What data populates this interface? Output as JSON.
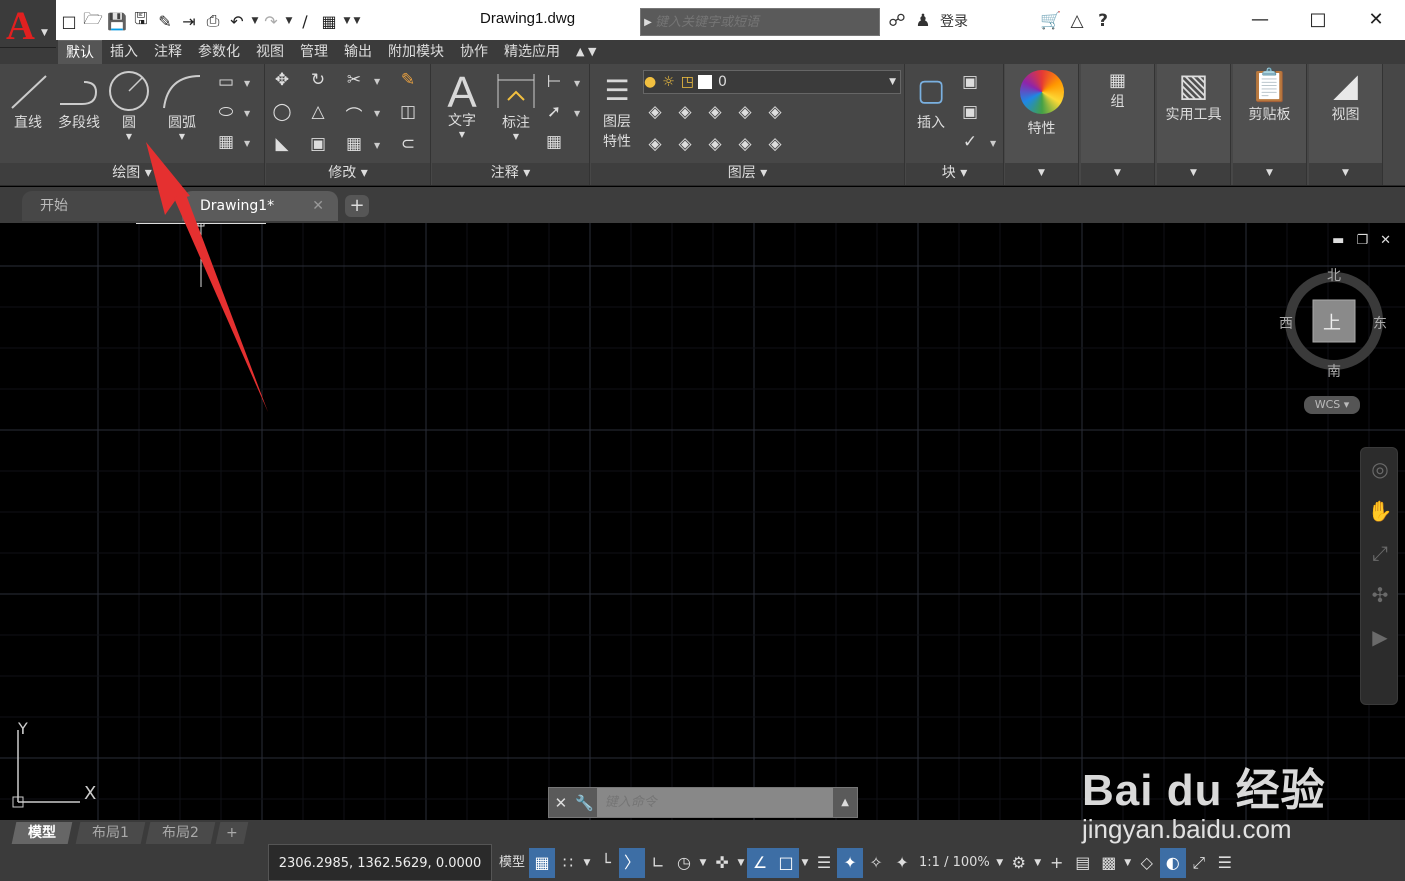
{
  "titlebar": {
    "doc_title": "Drawing1.dwg",
    "search_placeholder": "键入关键字或短语",
    "login_label": "登录"
  },
  "ribbon_tabs": [
    "默认",
    "插入",
    "注释",
    "参数化",
    "视图",
    "管理",
    "输出",
    "附加模块",
    "协作",
    "精选应用"
  ],
  "ribbon": {
    "draw": {
      "title": "绘图",
      "line": "直线",
      "polyline": "多段线",
      "circle": "圆",
      "arc": "圆弧"
    },
    "modify": {
      "title": "修改"
    },
    "annotation": {
      "title": "注释",
      "text": "文字",
      "dimension": "标注"
    },
    "layers": {
      "title": "图层",
      "layer_props": "图层特性",
      "current_layer": "0"
    },
    "block": {
      "title": "块",
      "insert": "插入"
    },
    "properties": {
      "label": "特性"
    },
    "groups": {
      "label": "组"
    },
    "utilities": {
      "label": "实用工具"
    },
    "clipboard": {
      "label": "剪贴板"
    },
    "view": {
      "label": "视图"
    }
  },
  "doc_tabs": {
    "start": "开始",
    "drawing": "Drawing1*"
  },
  "viewcube": {
    "north": "北",
    "south": "南",
    "east": "东",
    "west": "西",
    "face": "上",
    "wcs": "WCS"
  },
  "ucs": {
    "x": "X",
    "y": "Y"
  },
  "cmdline": {
    "placeholder": "键入命令"
  },
  "layout_tabs": [
    "模型",
    "布局1",
    "布局2"
  ],
  "statusbar": {
    "coords": "2306.2985, 1362.5629, 0.0000",
    "model": "模型",
    "scale": "1:1 / 100%"
  },
  "watermark": {
    "text": "Bai du 经验",
    "url": "jingyan.baidu.com"
  },
  "colors": {
    "accent": "#3d6ea5",
    "logo_red": "#e02020",
    "annotation_arrow": "#e53030"
  }
}
